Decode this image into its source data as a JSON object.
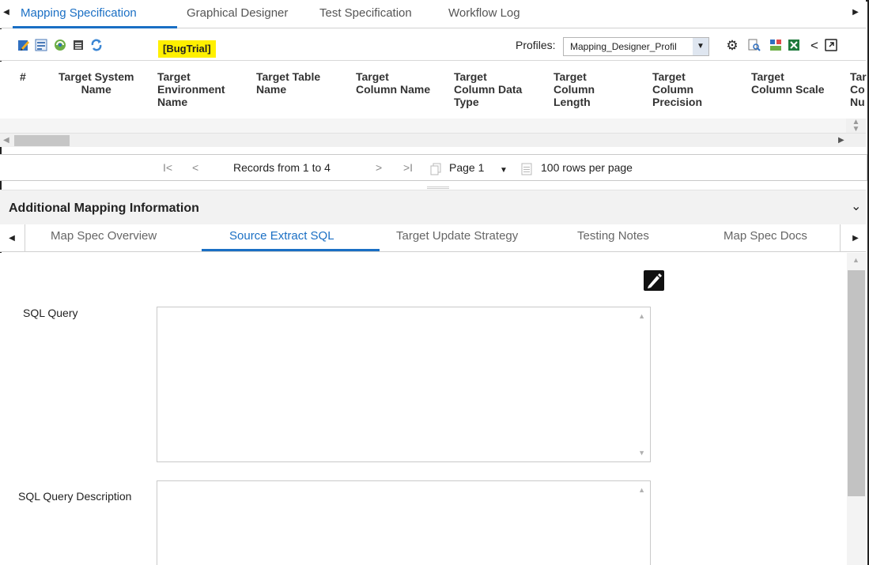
{
  "top_tabs": [
    {
      "label": "Mapping Specification",
      "active": true
    },
    {
      "label": "Graphical Designer",
      "active": false
    },
    {
      "label": "Test Specification",
      "active": false
    },
    {
      "label": "Workflow Log",
      "active": false
    }
  ],
  "toolbar": {
    "badge": "[BugTrial]",
    "profiles_label": "Profiles:",
    "profile_value": "Mapping_Designer_Profil",
    "left_icons": [
      "edit-sheet-icon",
      "import-icon",
      "sync-icon",
      "list-icon",
      "refresh-icon"
    ],
    "right_icons": [
      "settings-gear-icon",
      "preview-search-icon",
      "etl-icon",
      "excel-export-icon",
      "share-icon",
      "popout-icon"
    ]
  },
  "grid": {
    "columns": [
      "#",
      "Target System Name",
      "Target Environment Name",
      "Target Table Name",
      "Target Column Name",
      "Target Column Data Type",
      "Target Column Length",
      "Target Column Precision",
      "Target Column Scale",
      "Tar Co Nu"
    ],
    "header_lines": {
      "c0": [
        "#"
      ],
      "c1": [
        "Target System",
        "Name"
      ],
      "c2": [
        "Target",
        "Environment",
        "Name"
      ],
      "c3": [
        "Target Table",
        "Name"
      ],
      "c4": [
        "Target",
        "Column Name"
      ],
      "c5": [
        "Target",
        "Column Data",
        "Type"
      ],
      "c6": [
        "Target",
        "Column",
        "Length"
      ],
      "c7": [
        "Target",
        "Column",
        "Precision"
      ],
      "c8": [
        "Target",
        "Column Scale"
      ],
      "c9": [
        "Tar",
        "Co",
        "Nu"
      ]
    }
  },
  "pager": {
    "first": "I<",
    "prev": "<",
    "records": "Records from 1 to 4",
    "next": ">",
    "last": ">I",
    "page": "Page 1",
    "rows_per_page": "100 rows per page"
  },
  "additional": {
    "title": "Additional Mapping Information",
    "tabs": [
      {
        "label": "Map Spec Overview",
        "active": false
      },
      {
        "label": "Source Extract SQL",
        "active": true
      },
      {
        "label": "Target Update Strategy",
        "active": false
      },
      {
        "label": "Testing Notes",
        "active": false
      },
      {
        "label": "Map Spec Docs",
        "active": false
      }
    ],
    "fields": {
      "sql_query_label": "SQL Query",
      "sql_desc_label": "SQL Query Description"
    }
  },
  "colors": {
    "accent": "#1a6fc4",
    "badge_bg": "#fff000",
    "section_bg": "#f2f2f2"
  }
}
